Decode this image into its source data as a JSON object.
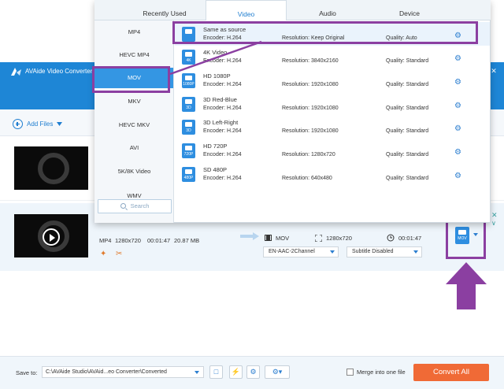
{
  "app": {
    "title": "AVAide Video Converter",
    "window_buttons": [
      "—",
      "☐",
      "✕"
    ]
  },
  "toolbar": {
    "add_files": "Add Files"
  },
  "tabs": [
    {
      "label": "Recently Used",
      "active": false
    },
    {
      "label": "Video",
      "active": true
    },
    {
      "label": "Audio",
      "active": false
    },
    {
      "label": "Device",
      "active": false
    }
  ],
  "categories": [
    {
      "label": "MP4",
      "active": false
    },
    {
      "label": "HEVC MP4",
      "active": false
    },
    {
      "label": "MOV",
      "active": true
    },
    {
      "label": "MKV",
      "active": false
    },
    {
      "label": "HEVC MKV",
      "active": false
    },
    {
      "label": "AVI",
      "active": false
    },
    {
      "label": "5K/8K Video",
      "active": false
    },
    {
      "label": "WMV",
      "active": false
    }
  ],
  "search": {
    "placeholder": "Search"
  },
  "presets": [
    {
      "name": "Same as source",
      "badge": "",
      "encoder": "Encoder: H.264",
      "resolution": "Resolution: Keep Original",
      "quality": "Quality: Auto"
    },
    {
      "name": "4K Video",
      "badge": "4K",
      "encoder": "Encoder: H.264",
      "resolution": "Resolution: 3840x2160",
      "quality": "Quality: Standard"
    },
    {
      "name": "HD 1080P",
      "badge": "1080P",
      "encoder": "Encoder: H.264",
      "resolution": "Resolution: 1920x1080",
      "quality": "Quality: Standard"
    },
    {
      "name": "3D Red-Blue",
      "badge": "3D",
      "encoder": "Encoder: H.264",
      "resolution": "Resolution: 1920x1080",
      "quality": "Quality: Standard"
    },
    {
      "name": "3D Left-Right",
      "badge": "3D",
      "encoder": "Encoder: H.264",
      "resolution": "Resolution: 1920x1080",
      "quality": "Quality: Standard"
    },
    {
      "name": "HD 720P",
      "badge": "720P",
      "encoder": "Encoder: H.264",
      "resolution": "Resolution: 1280x720",
      "quality": "Quality: Standard"
    },
    {
      "name": "SD 480P",
      "badge": "480P",
      "encoder": "Encoder: H.264",
      "resolution": "Resolution: 640x480",
      "quality": "Quality: Standard"
    }
  ],
  "file": {
    "source_format": "MP4",
    "source_resolution": "1280x720",
    "source_duration": "00:01:47",
    "source_size": "20.87 MB",
    "output_format": "MOV",
    "output_resolution": "1280x720",
    "output_duration": "00:01:47",
    "audio_track": "EN-AAC-2Channel",
    "subtitle": "Subtitle Disabled",
    "format_chip": "MOV"
  },
  "bottom": {
    "save_to_label": "Save to:",
    "save_path": "C:\\AVAide Studio\\AVAid...eo Converter\\Converted",
    "merge_label": "Merge into one file",
    "convert_all": "Convert All"
  },
  "colors": {
    "accent": "#1e86d6",
    "highlight": "#8b3fa1",
    "convert": "#f06a36"
  }
}
